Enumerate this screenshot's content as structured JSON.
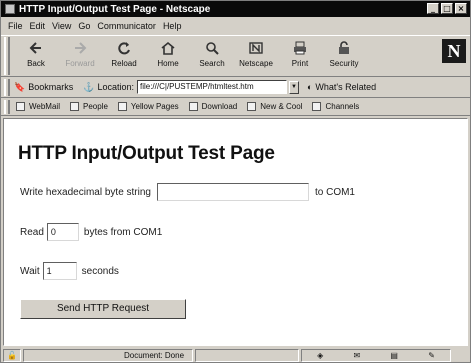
{
  "window": {
    "title": "HTTP Input/Output Test Page - Netscape",
    "controls": [
      "_",
      "□",
      "×"
    ]
  },
  "menu": [
    "File",
    "Edit",
    "View",
    "Go",
    "Communicator",
    "Help"
  ],
  "toolbar": [
    {
      "label": "Back",
      "icon": "back-arrow-icon",
      "disabled": false
    },
    {
      "label": "Forward",
      "icon": "forward-arrow-icon",
      "disabled": true
    },
    {
      "label": "Reload",
      "icon": "reload-icon",
      "disabled": false
    },
    {
      "label": "Home",
      "icon": "home-icon",
      "disabled": false
    },
    {
      "label": "Search",
      "icon": "search-icon",
      "disabled": false
    },
    {
      "label": "Netscape",
      "icon": "netscape-icon",
      "disabled": false
    },
    {
      "label": "Print",
      "icon": "print-icon",
      "disabled": false
    },
    {
      "label": "Security",
      "icon": "security-lock-icon",
      "disabled": false
    }
  ],
  "logo": "N",
  "location": {
    "bookmarks_label": "Bookmarks",
    "location_label": "Location:",
    "url": "file:///C|/PUSTEMP/htmltest.htm",
    "whats_related": "What's Related"
  },
  "personal_toolbar": [
    "WebMail",
    "People",
    "Yellow Pages",
    "Download",
    "New & Cool",
    "Channels"
  ],
  "page": {
    "title": "HTTP Input/Output Test Page",
    "write_label_pre": "Write hexadecimal byte string",
    "write_value": "",
    "write_label_post": "to COM1",
    "read_label_pre": "Read",
    "read_value": "0",
    "read_label_post": "bytes from COM1",
    "wait_label_pre": "Wait",
    "wait_value": "1",
    "wait_label_post": "seconds",
    "submit_label": "Send HTTP Request"
  },
  "status": {
    "text": "Document: Done"
  }
}
